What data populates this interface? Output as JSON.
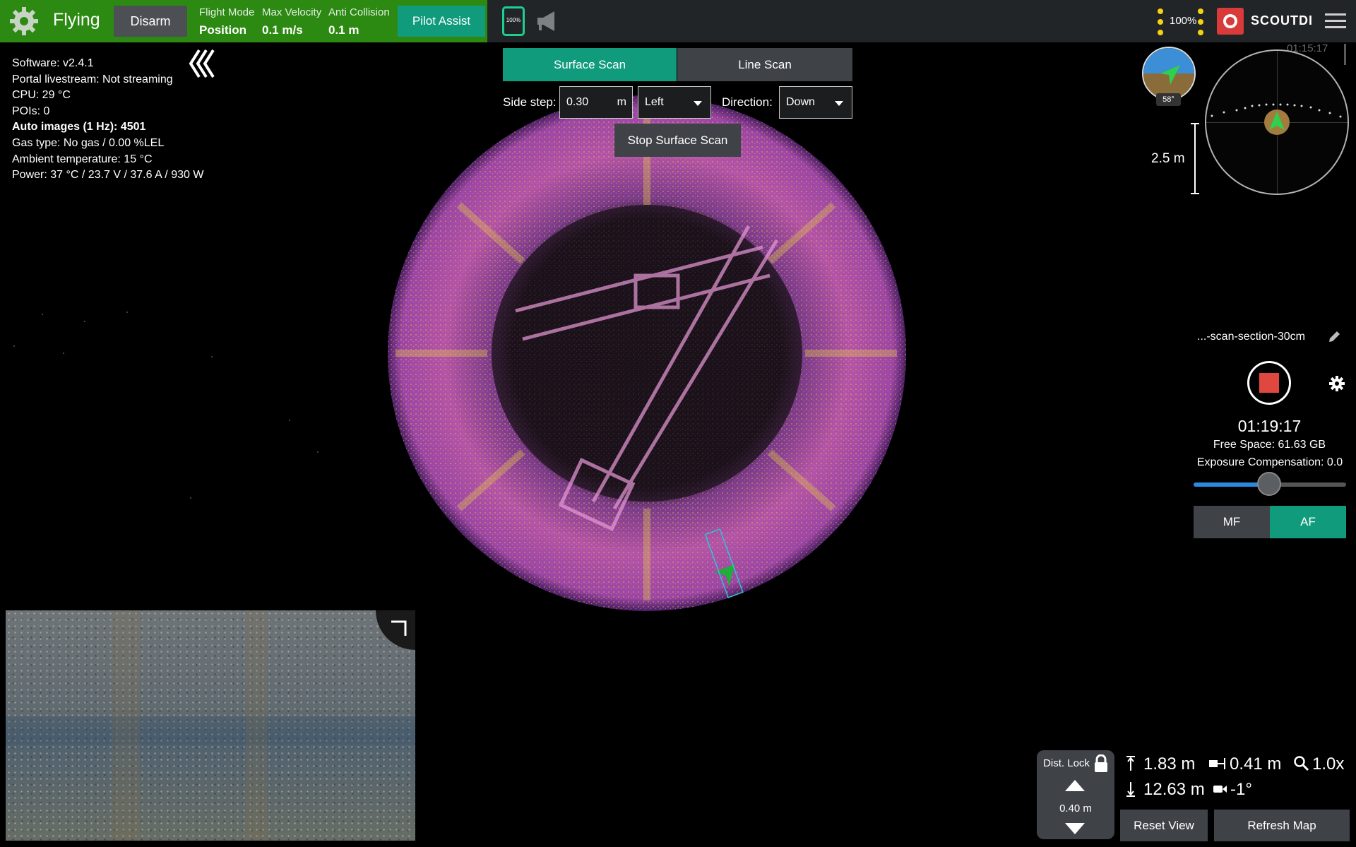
{
  "header": {
    "status": "Flying",
    "disarm_label": "Disarm",
    "flight_mode_label": "Flight Mode",
    "flight_mode_value": "Position",
    "max_velocity_label": "Max Velocity",
    "max_velocity_value": "0.1 m/s",
    "anti_collision_label": "Anti Collision",
    "anti_collision_value": "0.1 m",
    "pilot_assist_label": "Pilot Assist",
    "tablet_battery": "100%",
    "light_level": "100%",
    "brand": "SCOUTDI",
    "flight_time": "01:15:17",
    "status_bar_color": "#2c8a13",
    "accent_color": "#0f9b7c"
  },
  "info": {
    "software": "Software: v2.4.1",
    "livestream": "Portal livestream: Not streaming",
    "cpu": "CPU: 29 °C",
    "pois": "POIs: 0",
    "auto_images": "Auto images (1 Hz): 4501",
    "gas": "Gas type: No gas / 0.00 %LEL",
    "ambient": "Ambient temperature: 15 °C",
    "power": "Power: 37 °C / 23.7 V / 37.6 A / 930 W"
  },
  "scan": {
    "tab_surface": "Surface Scan",
    "tab_line": "Line Scan",
    "side_step_label": "Side step:",
    "side_step_value": "0.30",
    "side_step_unit": "m",
    "side_value": "Left",
    "direction_label": "Direction:",
    "direction_value": "Down",
    "stop_label": "Stop Surface Scan"
  },
  "nav": {
    "heading": "58°",
    "scale_label": "2.5 m"
  },
  "recording": {
    "name": "...-scan-section-30cm",
    "time": "01:19:17",
    "free_space": "Free Space: 61.63 GB",
    "exposure": "Exposure Compensation: 0.0",
    "exposure_level": 0.5,
    "mf_label": "MF",
    "af_label": "AF"
  },
  "dist_lock": {
    "label": "Dist. Lock",
    "value": "0.40 m"
  },
  "telemetry": {
    "up_distance": "1.83 m",
    "front_distance": "0.41 m",
    "zoom": "1.0x",
    "down_distance": "12.63 m",
    "gimbal_pitch": "-1°"
  },
  "footer": {
    "reset_view": "Reset View",
    "refresh_map": "Refresh Map"
  }
}
